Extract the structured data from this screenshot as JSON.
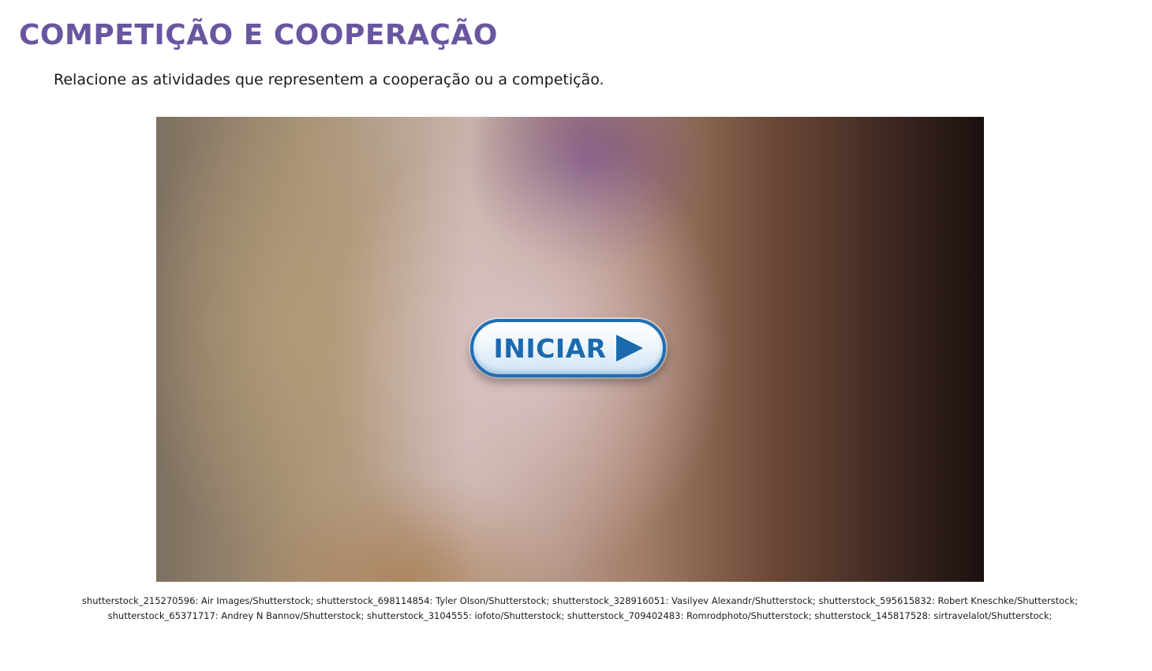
{
  "page": {
    "title": "COMPETIÇÃO E COOPERAÇÃO",
    "instruction": "Relacione as atividades que representem a cooperação ou a competição."
  },
  "media": {
    "start_button_label": "INICIAR",
    "start_button_icon": "play-icon"
  },
  "credits": {
    "text": "shutterstock_215270596: Air Images/Shutterstock; shutterstock_698114854: Tyler Olson/Shutterstock; shutterstock_328916051: Vasilyev Alexandr/Shutterstock; shutterstock_595615832: Robert Kneschke/Shutterstock; shutterstock_65371717: Andrey N Bannov/Shutterstock; shutterstock_3104555: iofoto/Shutterstock; shutterstock_709402483: Romrodphoto/Shutterstock; shutterstock_145817528: sirtravelalot/Shutterstock;"
  },
  "colors": {
    "title": "#6a56a0",
    "button_accent": "#1c6aae"
  }
}
